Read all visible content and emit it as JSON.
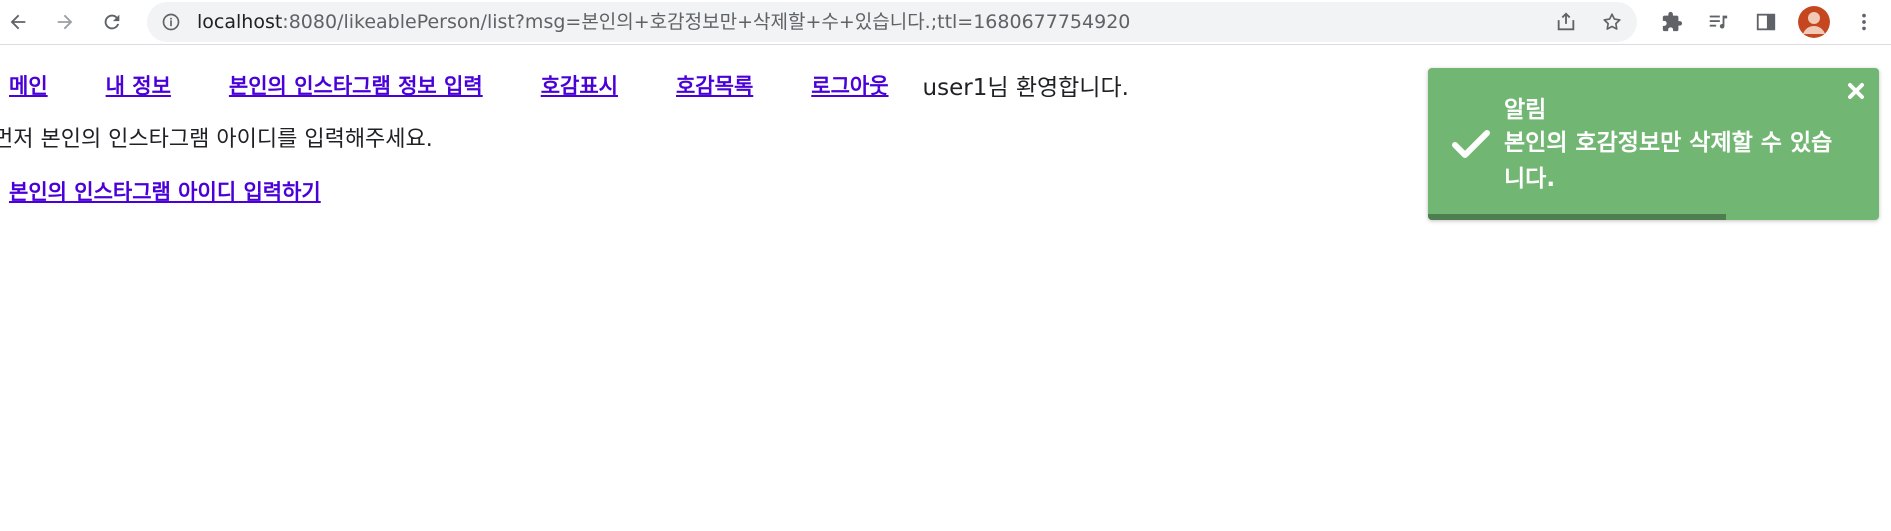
{
  "browser": {
    "url_host": "localhost",
    "url_rest": ":8080/likeablePerson/list?msg=본인의+호감정보만+삭제할+수+있습니다.;ttl=1680677754920",
    "icons": {
      "back": "arrow-left-icon",
      "forward": "arrow-right-icon",
      "reload": "reload-icon",
      "site_info": "info-icon",
      "share": "share-icon",
      "bookmark": "star-icon",
      "extensions": "puzzle-icon",
      "media": "media-playlist-icon",
      "side_panel": "side-panel-icon",
      "profile": "profile-avatar",
      "menu": "kebab-menu-icon"
    }
  },
  "nav": {
    "items": [
      {
        "label": "메인"
      },
      {
        "label": "내 정보"
      },
      {
        "label": "본인의 인스타그램 정보 입력"
      },
      {
        "label": "호감표시"
      },
      {
        "label": "호감목록"
      },
      {
        "label": "로그아웃"
      }
    ],
    "welcome": "user1님 환영합니다."
  },
  "main": {
    "message": "먼저 본인의 인스타그램 아이디를 입력해주세요.",
    "link": "본인의 인스타그램 아이디 입력하기"
  },
  "toast": {
    "title": "알림",
    "body": "본인의 호감정보만 삭제할 수 있습니다.",
    "progress": 0.66,
    "color": "#72b673",
    "progress_color": "#4e7d4f"
  },
  "colors": {
    "link": "#4a00d8",
    "toolbar_bg": "#ffffff",
    "omnibox_bg": "#f1f3f4"
  }
}
